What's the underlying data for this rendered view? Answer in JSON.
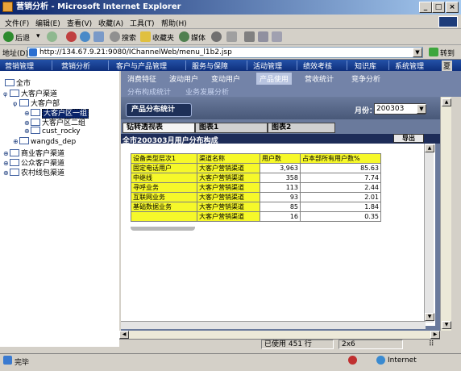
{
  "window": {
    "title": "营销分析 - Microsoft Internet Explorer",
    "min": "_",
    "max": "□",
    "close": "×"
  },
  "menu": [
    "文件(F)",
    "编辑(E)",
    "查看(V)",
    "收藏(A)",
    "工具(T)",
    "帮助(H)"
  ],
  "toolbar": {
    "back": "后退",
    "search": "搜索",
    "favorites": "收藏夹",
    "media": "媒体"
  },
  "address": {
    "label": "地址(D)",
    "url": "http://134.67.9.21:9080/IChannelWeb/menu_l1b2.jsp",
    "go": "转到"
  },
  "topnav": [
    "营销管理",
    "营销分析",
    "客户与产品管理",
    "服务与保障",
    "活动管理",
    "绩效考核",
    "知识库",
    "系统管理",
    "夏"
  ],
  "subnav": {
    "row1": [
      "消费特征",
      "波动用户",
      "变动用户",
      "产品使用",
      "营收统计",
      "竞争分析"
    ],
    "active": "产品使用",
    "row2": [
      "分布构成统计",
      "业务发展分析"
    ]
  },
  "tree": {
    "root": "全市",
    "items": [
      {
        "label": "大客户渠道",
        "level": 1
      },
      {
        "label": "大客户部",
        "level": 2
      },
      {
        "label": "大客户区一组",
        "level": 3,
        "selected": true
      },
      {
        "label": "大客户区二组",
        "level": 3
      },
      {
        "label": "cust_rocky",
        "level": 3
      },
      {
        "label": "wangds_dep",
        "level": 2
      },
      {
        "label": "商业客户渠道",
        "level": 1
      },
      {
        "label": "公众客户渠道",
        "level": 1
      },
      {
        "label": "农村线包渠道",
        "level": 1
      }
    ]
  },
  "panel": {
    "button": "产品分布统计",
    "month_label": "月份：",
    "month_value": "200303",
    "tabs": [
      "钻转透视表",
      "图表1",
      "图表2"
    ],
    "subtitle": "全市200303月用户分布构成",
    "export": "导出"
  },
  "grid": {
    "headers": [
      "设备类型层次1",
      "渠道名称",
      "用户数",
      "占本部所有用户数%"
    ],
    "rows": [
      [
        "固定电话用户",
        "大客户营销渠道",
        "3,963",
        "85.63"
      ],
      [
        "中继线",
        "大客户营销渠道",
        "358",
        "7.74"
      ],
      [
        "寻呼业务",
        "大客户营销渠道",
        "113",
        "2.44"
      ],
      [
        "互联网业务",
        "大客户营销渠道",
        "93",
        "2.01"
      ],
      [
        "基础数据业务",
        "大客户营销渠道",
        "85",
        "1.84"
      ],
      [
        "",
        "大客户营销渠道",
        "16",
        "0.35"
      ]
    ]
  },
  "innerstatus": {
    "used": "已使用 451 行",
    "size": "2x6"
  },
  "status": {
    "left": "完毕",
    "zone": "Internet"
  },
  "colors": {
    "topnav": "#1a3f94",
    "highlight": "#f6f82a",
    "panel": "#6a7a9c"
  }
}
